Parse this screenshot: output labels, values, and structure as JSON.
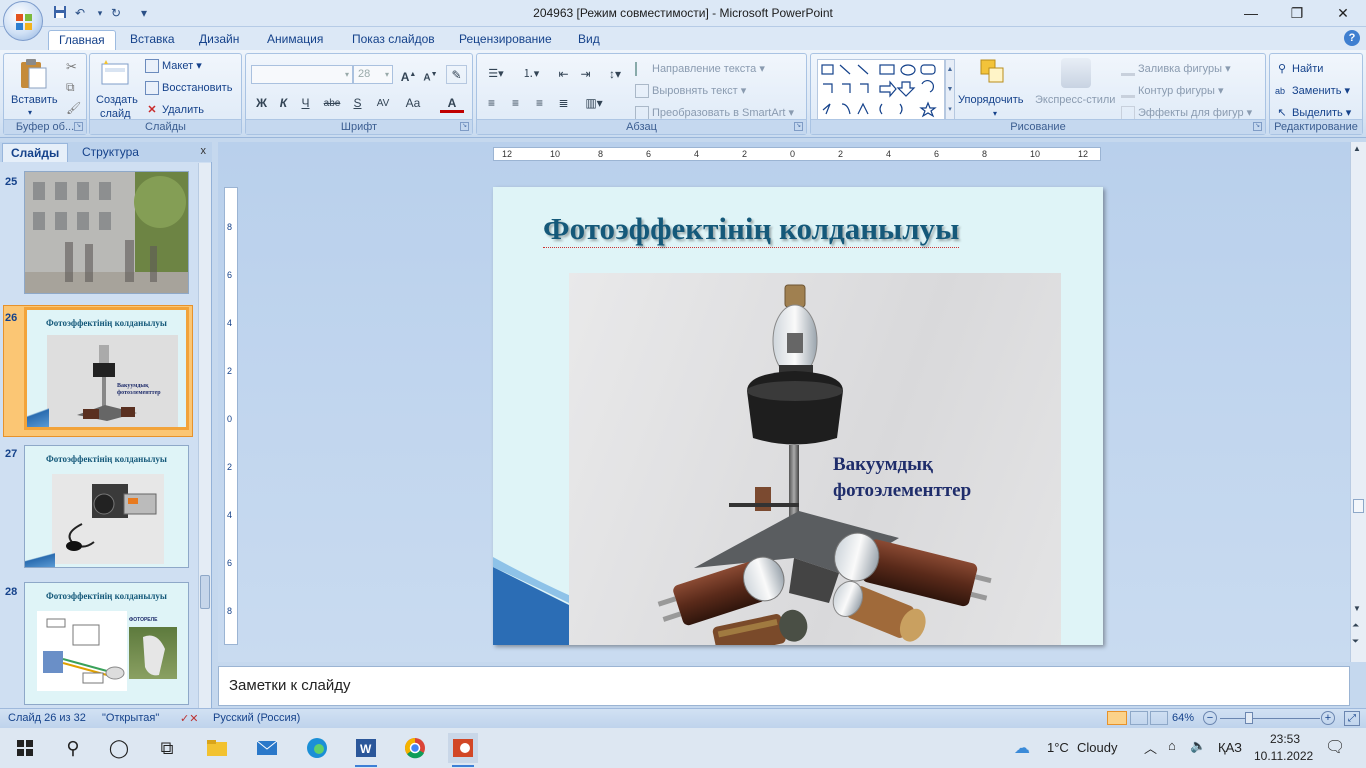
{
  "window": {
    "title": "204963 [Режим совместимости] - Microsoft PowerPoint",
    "minimize": "—",
    "restore": "❐",
    "close": "✕"
  },
  "quick_access": {
    "save": "save-icon",
    "undo": "↶",
    "redo": "↻",
    "customize": "▾"
  },
  "tabs": [
    "Главная",
    "Вставка",
    "Дизайн",
    "Анимация",
    "Показ слайдов",
    "Рецензирование",
    "Вид"
  ],
  "active_tab": "Главная",
  "ribbon": {
    "clipboard": {
      "label": "Буфер об...",
      "paste": "Вставить"
    },
    "slides": {
      "label": "Слайды",
      "new_slide_1": "Создать",
      "new_slide_2": "слайд",
      "layout": "Макет",
      "reset": "Восстановить",
      "delete": "Удалить"
    },
    "font": {
      "label": "Шрифт",
      "size": "28",
      "bold": "Ж",
      "italic": "К",
      "underline": "Ч",
      "strike": "abe",
      "shadow": "S",
      "spacing": "AV",
      "case": "Aa",
      "color": "A"
    },
    "paragraph": {
      "label": "Абзац",
      "text_direction": "Направление текста",
      "align_text": "Выровнять текст",
      "smartart": "Преобразовать в SmartArt"
    },
    "drawing": {
      "label": "Рисование",
      "arrange": "Упорядочить",
      "quick_styles": "Экспресс-стили",
      "fill": "Заливка фигуры",
      "outline": "Контур фигуры",
      "effects": "Эффекты для фигур"
    },
    "editing": {
      "label": "Редактирование",
      "find": "Найти",
      "replace": "Заменить",
      "select": "Выделить"
    }
  },
  "panel": {
    "tabs": [
      "Слайды",
      "Структура"
    ],
    "close": "x",
    "slides": [
      {
        "num": "25",
        "title": ""
      },
      {
        "num": "26",
        "title": "Фотоэффектінің колданылуы",
        "caption1": "Вакуумдық",
        "caption2": "фотоэлементтер"
      },
      {
        "num": "27",
        "title": "Фотоэффектінің колданылуы"
      },
      {
        "num": "28",
        "title": "Фотоэффектінің колданылуы",
        "extra": "ФОТОРЕЛЕ"
      }
    ]
  },
  "ruler": {
    "h_ticks": [
      "12",
      "10",
      "8",
      "6",
      "4",
      "2",
      "0",
      "2",
      "4",
      "6",
      "8",
      "10",
      "12"
    ],
    "v_ticks": [
      "8",
      "6",
      "4",
      "2",
      "0",
      "2",
      "4",
      "6",
      "8"
    ]
  },
  "slide": {
    "title": "Фотоэффектінің колданылуы",
    "caption_line1": "Вакуумдық",
    "caption_line2": "фотоэлементтер"
  },
  "notes": {
    "placeholder": "Заметки к слайду"
  },
  "status": {
    "slide_of": "Слайд 26 из 32",
    "theme": "\"Открытая\"",
    "language": "Русский (Россия)",
    "zoom": "64%"
  },
  "taskbar": {
    "weather_temp": "1°C",
    "weather_text": "Cloudy",
    "lang": "ҚАЗ",
    "time": "23:53",
    "date": "10.11.2022"
  },
  "colors": {
    "accent": "#15428b",
    "slide_bg": "#dff4f7",
    "title": "#15597a",
    "selection": "#f2a33a"
  }
}
